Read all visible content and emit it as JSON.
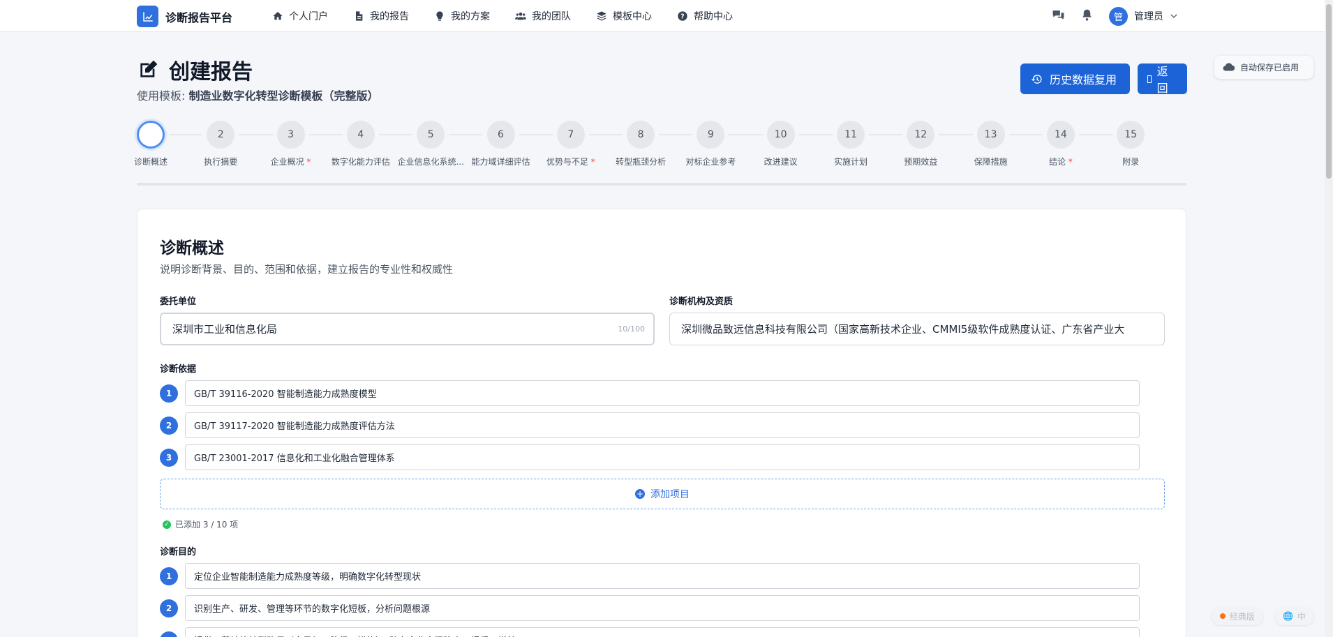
{
  "brand": {
    "name": "诊断报告平台"
  },
  "nav": {
    "items": [
      {
        "label": "个人门户",
        "icon": "home-icon"
      },
      {
        "label": "我的报告",
        "icon": "file-icon"
      },
      {
        "label": "我的方案",
        "icon": "lightbulb-icon"
      },
      {
        "label": "我的团队",
        "icon": "team-icon"
      },
      {
        "label": "模板中心",
        "icon": "layers-icon"
      },
      {
        "label": "帮助中心",
        "icon": "help-icon"
      }
    ],
    "user": {
      "avatar_text": "管",
      "name": "管理员"
    }
  },
  "header": {
    "title": "创建报告",
    "template_prefix": "使用模板: ",
    "template_name": "制造业数字化转型诊断模板（完整版）",
    "history_button": "历史数据复用",
    "back_button": "返回",
    "autosave": "自动保存已启用"
  },
  "steps": [
    {
      "num": "",
      "label": "诊断概述",
      "required": false,
      "active": true
    },
    {
      "num": "2",
      "label": "执行摘要",
      "required": false
    },
    {
      "num": "3",
      "label": "企业概况",
      "required": true
    },
    {
      "num": "4",
      "label": "数字化能力评估",
      "required": false
    },
    {
      "num": "5",
      "label": "企业信息化系统...",
      "required": false
    },
    {
      "num": "6",
      "label": "能力域详细评估",
      "required": false
    },
    {
      "num": "7",
      "label": "优势与不足",
      "required": true
    },
    {
      "num": "8",
      "label": "转型瓶颈分析",
      "required": false
    },
    {
      "num": "9",
      "label": "对标企业参考",
      "required": false
    },
    {
      "num": "10",
      "label": "改进建议",
      "required": false
    },
    {
      "num": "11",
      "label": "实施计划",
      "required": false
    },
    {
      "num": "12",
      "label": "预期效益",
      "required": false
    },
    {
      "num": "13",
      "label": "保障措施",
      "required": false
    },
    {
      "num": "14",
      "label": "结论",
      "required": true
    },
    {
      "num": "15",
      "label": "附录",
      "required": false
    }
  ],
  "section": {
    "title": "诊断概述",
    "description": "说明诊断背景、目的、范围和依据，建立报告的专业性和权威性",
    "client": {
      "label": "委托单位",
      "value": "深圳市工业和信息化局",
      "counter": "10/100"
    },
    "agency": {
      "label": "诊断机构及资质",
      "value": "深圳微品致远信息科技有限公司（国家高新技术企业、CMMI5级软件成熟度认证、广东省产业大"
    },
    "basis": {
      "label": "诊断依据",
      "items": [
        {
          "num": "1",
          "value": "GB/T 39116-2020 智能制造能力成熟度模型"
        },
        {
          "num": "2",
          "value": "GB/T 39117-2020 智能制造能力成熟度评估方法"
        },
        {
          "num": "3",
          "value": "GB/T 23001-2017 信息化和工业化融合管理体系"
        }
      ],
      "add_label": "添加项目",
      "added_text": "已添加 3 / 10 项"
    },
    "purpose": {
      "label": "诊断目的",
      "items": [
        {
          "num": "1",
          "value": "定位企业智能制造能力成熟度等级，明确数字化转型现状"
        },
        {
          "num": "2",
          "value": "识别生产、研发、管理等环节的数字化短板，分析问题根源"
        },
        {
          "num": "3",
          "value": "提供可落地的转型路径（含目标、路径、措施），助力企业实现降本、提质、增效"
        }
      ]
    }
  },
  "floating": {
    "classic": "经典版",
    "lang": "中"
  },
  "colors": {
    "primary": "#1d63d8",
    "accent": "#2f6fde",
    "required": "#ef4444"
  }
}
